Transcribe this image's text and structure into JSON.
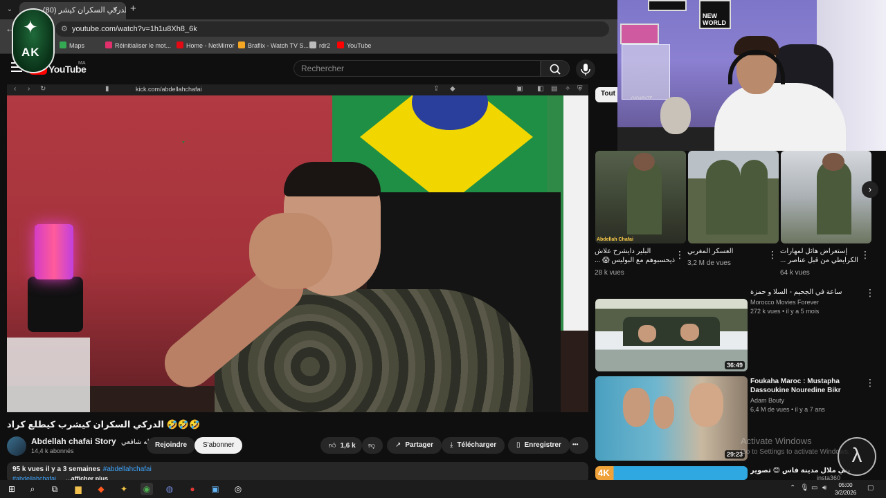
{
  "browser": {
    "tab_title": "(80) الدركي السكران كيشر...",
    "tab_close": "×",
    "new_tab": "+",
    "url": "youtube.com/watch?v=1h1u8Xh8_6k",
    "bookmarks": [
      {
        "label": "Maps",
        "color": "#34a853"
      },
      {
        "label": "Réinitialiser le mot...",
        "color": "#e1306c"
      },
      {
        "label": "Home - NetMirror",
        "color": "#e50914"
      },
      {
        "label": "Braflix - Watch TV S...",
        "color": "#f5a623"
      },
      {
        "label": "rdr2",
        "color": "#bbbbbb"
      },
      {
        "label": "YouTube",
        "color": "#ff0000"
      }
    ]
  },
  "overlay_logo": {
    "text": "AK"
  },
  "youtube": {
    "wordmark": "YouTube",
    "country": "MA",
    "search_placeholder": "Rechercher"
  },
  "inner_browser": {
    "url": "kick.com/abdellahchafai"
  },
  "video": {
    "title": "🤣🤣🤣 الدركي السكران كيشرب كيطلع كراد",
    "channel": "Abdellah chafai Story",
    "channel_ar": "عبد الله شافعي",
    "subscribers": "14,4 k abonnés",
    "join_label": "Rejoindre",
    "subscribe_label": "S'abonner",
    "likes": "1,6 k",
    "share_label": "Partager",
    "download_label": "Télécharger",
    "save_label": "Enregistrer",
    "more_label": "•••",
    "desc_stats": "95 k vues  il y a 3 semaines",
    "desc_tag": "#abdellahchafai",
    "desc_line2": "#abdellahchafai",
    "desc_more": "...afficher plus"
  },
  "sidebar": {
    "chip": "Tout",
    "shorts": [
      {
        "title": "البلير دايشرح علاش ذيحسبوهم مع البوليس 😱 ...",
        "views": "28 k vues",
        "overlay": "Abdellah Chafai"
      },
      {
        "title": "العسكر المغربي",
        "views": "3,2 M de vues"
      },
      {
        "title": "إستعراض هائل لمهارات الكرايطي من قبل عناصر ...",
        "views": "64 k vues"
      }
    ],
    "recommendations": [
      {
        "title": "ساعة في الجحيم - السلا و حمزة",
        "channel": "Morocco Movies Forever",
        "meta": "272 k vues • il y a 5 mois",
        "duration": "36:49"
      },
      {
        "title": "Foukaha Maroc : Mustapha Dassoukine Nouredine Bikr",
        "channel": "Adam Bouty",
        "meta": "6,4 M de vues • il y a 7 ans",
        "duration": "29:23"
      },
      {
        "title": "بني ملال مدينة فاس 😊 تصوير بالدرامي بكميرة",
        "channel": "insta360",
        "meta": "",
        "duration": "",
        "badge": "4K"
      }
    ]
  },
  "webcam": {
    "posters": [
      "NEW WORLD"
    ],
    "brand": "GIGABYTE"
  },
  "windows": {
    "activate_title": "Activate Windows",
    "activate_sub": "Go to Settings to activate Windows.",
    "time": "05:00",
    "date": "3/2/2026"
  }
}
